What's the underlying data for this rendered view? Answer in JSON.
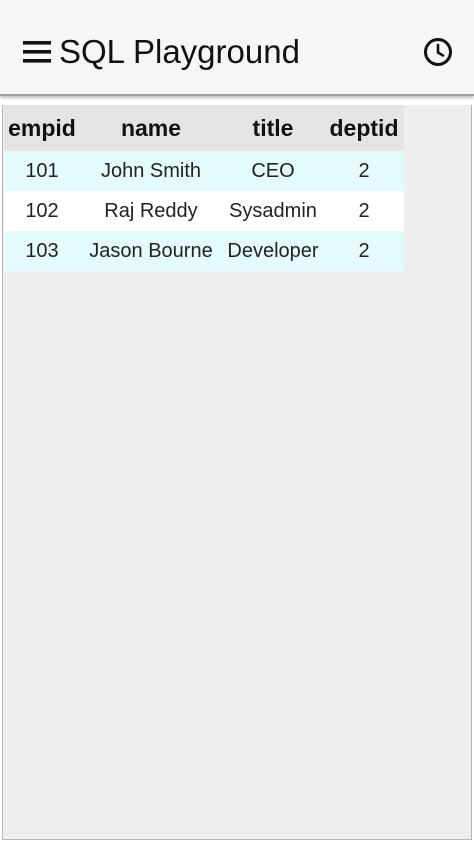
{
  "app_bar": {
    "title": "SQL Playground",
    "menu_icon": "hamburger-menu-icon",
    "history_icon": "clock-history-icon"
  },
  "results": {
    "columns": [
      "empid",
      "name",
      "title",
      "deptid"
    ],
    "rows": [
      [
        "101",
        "John Smith",
        "CEO",
        "2"
      ],
      [
        "102",
        "Raj Reddy",
        "Sysadmin",
        "2"
      ],
      [
        "103",
        "Jason Bourne",
        "Developer",
        "2"
      ]
    ]
  },
  "colors": {
    "header_bg": "#f6f6f6",
    "table_header_bg": "#e4e4e4",
    "row_highlight": "#e5fbfb",
    "row_plain": "#ffffff",
    "content_bg": "#eeeeee"
  }
}
